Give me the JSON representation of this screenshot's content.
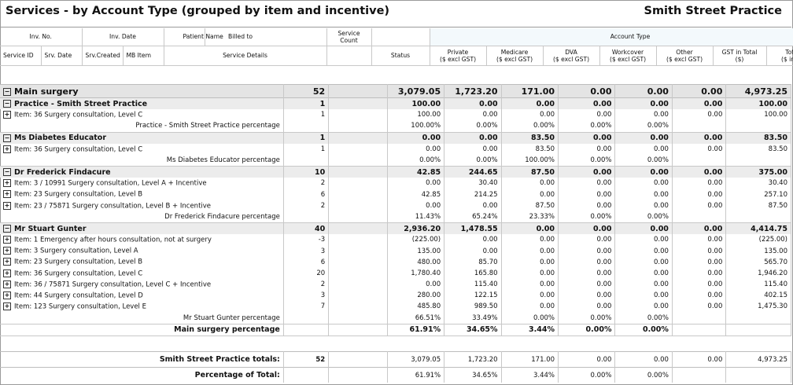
{
  "report": {
    "title": "Services - by Account Type (grouped by item and incentive)",
    "practice": "Smith Street Practice"
  },
  "header": {
    "inv_no": "Inv. No.",
    "inv_date": "Inv. Date",
    "patient_name": "Patient Name",
    "billed_to": "Billed to",
    "service_count": "Service Count",
    "account_type": "Account Type",
    "service_id": "Service ID",
    "srv_date": "Srv. Date",
    "srv_created": "Srv.Created",
    "mb_item": "MB Item",
    "service_details": "Service Details",
    "status": "Status",
    "cols": [
      {
        "name": "Private",
        "unit": "($ excl GST)"
      },
      {
        "name": "Medicare",
        "unit": "($ excl GST)"
      },
      {
        "name": "DVA",
        "unit": "($ excl GST)"
      },
      {
        "name": "Workcover",
        "unit": "($ excl GST)"
      },
      {
        "name": "Other",
        "unit": "($ excl GST)"
      },
      {
        "name": "GST in Total",
        "unit": "($)"
      },
      {
        "name": "Total Fee",
        "unit": "($ incl GST)"
      }
    ]
  },
  "rows": [
    {
      "kind": "top",
      "label": "Main surgery",
      "count": "52",
      "vals": [
        "3,079.05",
        "1,723.20",
        "171.00",
        "0.00",
        "0.00",
        "0.00",
        "4,973.25"
      ]
    },
    {
      "kind": "grp",
      "label": "Practice - Smith Street Practice",
      "count": "1",
      "vals": [
        "100.00",
        "0.00",
        "0.00",
        "0.00",
        "0.00",
        "0.00",
        "100.00"
      ]
    },
    {
      "kind": "item",
      "label": "Item: 36 Surgery consultation, Level C",
      "count": "1",
      "vals": [
        "100.00",
        "0.00",
        "0.00",
        "0.00",
        "0.00",
        "0.00",
        "100.00"
      ]
    },
    {
      "kind": "pct",
      "label": "Practice - Smith Street Practice percentage",
      "vals": [
        "100.00%",
        "0.00%",
        "0.00%",
        "0.00%",
        "0.00%",
        "",
        ""
      ]
    },
    {
      "kind": "grp",
      "label": "Ms Diabetes Educator",
      "count": "1",
      "vals": [
        "0.00",
        "0.00",
        "83.50",
        "0.00",
        "0.00",
        "0.00",
        "83.50"
      ]
    },
    {
      "kind": "item",
      "label": "Item: 36 Surgery consultation, Level C",
      "count": "1",
      "vals": [
        "0.00",
        "0.00",
        "83.50",
        "0.00",
        "0.00",
        "0.00",
        "83.50"
      ]
    },
    {
      "kind": "pct",
      "label": "Ms Diabetes Educator percentage",
      "vals": [
        "0.00%",
        "0.00%",
        "100.00%",
        "0.00%",
        "0.00%",
        "",
        ""
      ]
    },
    {
      "kind": "grp",
      "label": "Dr Frederick Findacure",
      "count": "10",
      "vals": [
        "42.85",
        "244.65",
        "87.50",
        "0.00",
        "0.00",
        "0.00",
        "375.00"
      ]
    },
    {
      "kind": "item",
      "label": "Item: 3 / 10991 Surgery consultation, Level A + Incentive",
      "count": "2",
      "vals": [
        "0.00",
        "30.40",
        "0.00",
        "0.00",
        "0.00",
        "0.00",
        "30.40"
      ]
    },
    {
      "kind": "item",
      "label": "Item: 23 Surgery consultation, Level B",
      "count": "6",
      "vals": [
        "42.85",
        "214.25",
        "0.00",
        "0.00",
        "0.00",
        "0.00",
        "257.10"
      ]
    },
    {
      "kind": "item",
      "label": "Item: 23 / 75871 Surgery consultation, Level B + Incentive",
      "count": "2",
      "vals": [
        "0.00",
        "0.00",
        "87.50",
        "0.00",
        "0.00",
        "0.00",
        "87.50"
      ]
    },
    {
      "kind": "pct",
      "label": "Dr Frederick Findacure percentage",
      "vals": [
        "11.43%",
        "65.24%",
        "23.33%",
        "0.00%",
        "0.00%",
        "",
        ""
      ]
    },
    {
      "kind": "grp",
      "label": "Mr Stuart Gunter",
      "count": "40",
      "vals": [
        "2,936.20",
        "1,478.55",
        "0.00",
        "0.00",
        "0.00",
        "0.00",
        "4,414.75"
      ]
    },
    {
      "kind": "item",
      "label": "Item: 1 Emergency after hours consultation, not at surgery",
      "count": "-3",
      "vals": [
        "(225.00)",
        "0.00",
        "0.00",
        "0.00",
        "0.00",
        "0.00",
        "(225.00)"
      ]
    },
    {
      "kind": "item",
      "label": "Item: 3 Surgery consultation, Level A",
      "count": "3",
      "vals": [
        "135.00",
        "0.00",
        "0.00",
        "0.00",
        "0.00",
        "0.00",
        "135.00"
      ]
    },
    {
      "kind": "item",
      "label": "Item: 23 Surgery consultation, Level B",
      "count": "6",
      "vals": [
        "480.00",
        "85.70",
        "0.00",
        "0.00",
        "0.00",
        "0.00",
        "565.70"
      ]
    },
    {
      "kind": "item",
      "label": "Item: 36 Surgery consultation, Level C",
      "count": "20",
      "vals": [
        "1,780.40",
        "165.80",
        "0.00",
        "0.00",
        "0.00",
        "0.00",
        "1,946.20"
      ]
    },
    {
      "kind": "item",
      "label": "Item: 36 / 75871 Surgery consultation, Level C + Incentive",
      "count": "2",
      "vals": [
        "0.00",
        "115.40",
        "0.00",
        "0.00",
        "0.00",
        "0.00",
        "115.40"
      ]
    },
    {
      "kind": "item",
      "label": "Item: 44 Surgery consultation, Level D",
      "count": "3",
      "vals": [
        "280.00",
        "122.15",
        "0.00",
        "0.00",
        "0.00",
        "0.00",
        "402.15"
      ]
    },
    {
      "kind": "item",
      "label": "Item: 123 Surgery consultation, Level E",
      "count": "7",
      "vals": [
        "485.80",
        "989.50",
        "0.00",
        "0.00",
        "0.00",
        "0.00",
        "1,475.30"
      ]
    },
    {
      "kind": "pct",
      "label": "Mr Stuart Gunter percentage",
      "vals": [
        "66.51%",
        "33.49%",
        "0.00%",
        "0.00%",
        "0.00%",
        "",
        ""
      ]
    },
    {
      "kind": "pctbig",
      "label": "Main surgery percentage",
      "vals": [
        "61.91%",
        "34.65%",
        "3.44%",
        "0.00%",
        "0.00%",
        "",
        ""
      ]
    }
  ],
  "totals": {
    "label": "Smith Street Practice totals:",
    "count": "52",
    "vals": [
      "3,079.05",
      "1,723.20",
      "171.00",
      "0.00",
      "0.00",
      "0.00",
      "4,973.25"
    ],
    "pct_label": "Percentage of Total:",
    "pct_vals": [
      "61.91%",
      "34.65%",
      "3.44%",
      "0.00%",
      "0.00%",
      "",
      ""
    ]
  }
}
